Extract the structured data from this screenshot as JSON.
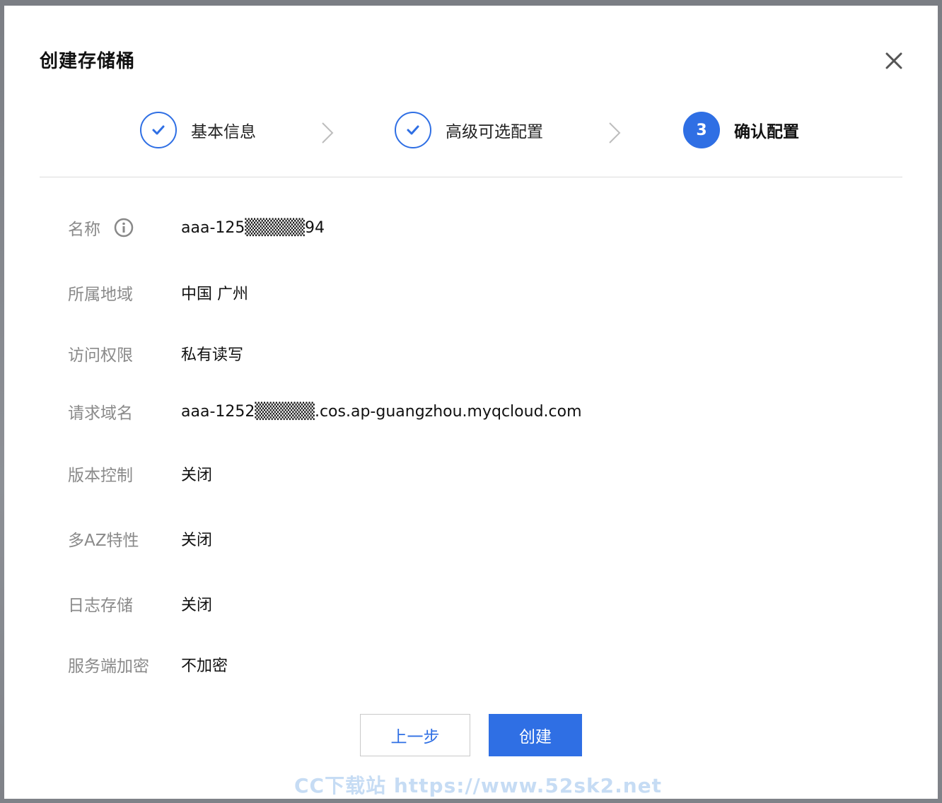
{
  "dialog": {
    "title": "创建存储桶",
    "close_icon": "close-icon"
  },
  "steps": [
    {
      "label": "基本信息",
      "status": "done",
      "icon": "check-icon"
    },
    {
      "label": "高级可选配置",
      "status": "done",
      "icon": "check-icon"
    },
    {
      "label": "确认配置",
      "status": "active",
      "number": "3"
    }
  ],
  "fields": [
    {
      "label": "名称",
      "value": "aaa-125▒▒▒▒▒94",
      "icon": "info-icon"
    },
    {
      "label": "所属地域",
      "value": "中国 广州"
    },
    {
      "label": "访问权限",
      "value": "私有读写"
    },
    {
      "label": "请求域名",
      "value": "aaa-1252▒▒▒▒▒.cos.ap-guangzhou.myqcloud.com"
    },
    {
      "label": "版本控制",
      "value": "关闭"
    },
    {
      "label": "多AZ特性",
      "value": "关闭"
    },
    {
      "label": "日志存储",
      "value": "关闭"
    },
    {
      "label": "服务端加密",
      "value": "不加密"
    }
  ],
  "buttons": {
    "prev": "上一步",
    "create": "创建"
  },
  "watermark": "CC下载站 https://www.52sk2.net",
  "colors": {
    "accent": "#2f6fe4",
    "label": "#8a8a8a",
    "text": "#111111"
  }
}
